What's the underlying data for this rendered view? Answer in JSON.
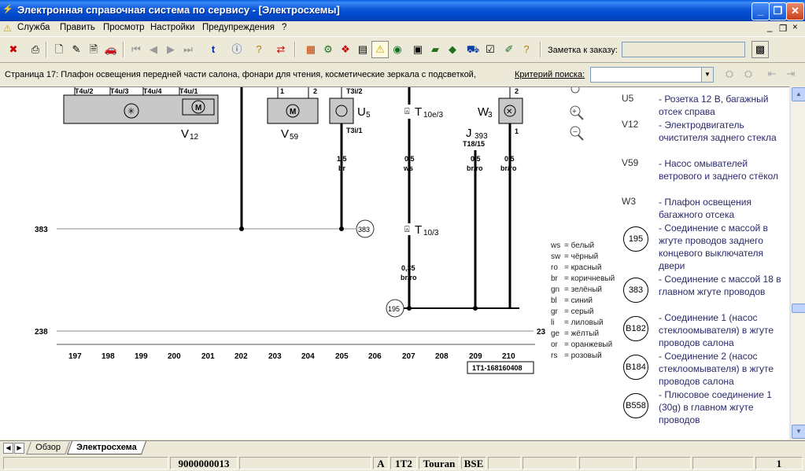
{
  "window": {
    "title": "Электронная справочная система по сервису - [Электросхемы]",
    "min": "_",
    "max": "❐",
    "close": "✕"
  },
  "menu": {
    "items": [
      "Служба",
      "Править",
      "Просмотр",
      "Настройки",
      "Предупреждения",
      "?"
    ],
    "doc_controls": [
      "_",
      "❐",
      "×"
    ]
  },
  "toolbar": {
    "note_label": "Заметка к заказу:",
    "note_value": ""
  },
  "pageline": {
    "page_text": "Страница 17: Плафон освещения передней части салона, фонари для чтения, косметические зеркала с подсветкой,",
    "criteria_label": "Критерий поиска:",
    "criteria_value": ""
  },
  "diagram": {
    "top_pins": [
      "T4u/2",
      "T4u/3",
      "T4u/4",
      "T4u/1"
    ],
    "pins_v59": [
      "1",
      "2"
    ],
    "pin_t3i2": "T3i/2",
    "pin_t3i1": "T3i/1",
    "pin_w3_2": "2",
    "pin_w3_1": "1",
    "labels": {
      "v12": "V",
      "v12_sub": "12",
      "v59": "V",
      "v59_sub": "59",
      "u5": "U",
      "u5_sub": "5",
      "w3": "W",
      "w3_sub": "3",
      "t10e3": "T",
      "t10e3_sub": "10e/3",
      "t103": "T",
      "t103_sub": "10/3",
      "j393": "J",
      "j393_sub": "393",
      "t1815": "T18/15"
    },
    "wires": [
      {
        "gauge": "1,5",
        "color": "br"
      },
      {
        "gauge": "0,5",
        "color": "ws"
      },
      {
        "gauge": "0,5",
        "color": "br/ro"
      },
      {
        "gauge": "0,5",
        "color": "br/ro"
      },
      {
        "gauge": "0,35",
        "color": "br/ro"
      }
    ],
    "rail_383": "383",
    "rail_238": "238",
    "rail_238_right": "23",
    "circle_383": "383",
    "circle_195": "195",
    "columns": [
      "197",
      "198",
      "199",
      "200",
      "201",
      "202",
      "203",
      "204",
      "205",
      "206",
      "207",
      "208",
      "209",
      "210"
    ],
    "drawing_id": "1T1-168160408"
  },
  "color_codes": [
    {
      "code": "ws",
      "name": "= белый"
    },
    {
      "code": "sw",
      "name": "= чёрный"
    },
    {
      "code": "ro",
      "name": "= красный"
    },
    {
      "code": "br",
      "name": "= коричневый"
    },
    {
      "code": "gn",
      "name": "= зелёный"
    },
    {
      "code": "bl",
      "name": "= синий"
    },
    {
      "code": "gr",
      "name": "= серый"
    },
    {
      "code": "li",
      "name": "= лиловый"
    },
    {
      "code": "ge",
      "name": "= жёлтый"
    },
    {
      "code": "or",
      "name": "= оранжевый"
    },
    {
      "code": "rs",
      "name": "= розовый"
    }
  ],
  "legend": [
    {
      "code": "U5",
      "desc": "- Розетка 12 В, багажный отсек справа"
    },
    {
      "code": "V12",
      "desc": "- Электродвигатель очистителя заднего стекла"
    },
    {
      "code": "V59",
      "desc": "- Насос омывателей ветрового и заднего стёкол"
    },
    {
      "code": "W3",
      "desc": "- Плафон освещения багажного отсека"
    },
    {
      "circle": "195",
      "desc": "- Соединение с массой в жгуте проводов заднего концевого выключателя двери"
    },
    {
      "circle": "383",
      "desc": "- Соединение с массой 18 в главном жгуте проводов"
    },
    {
      "circle": "B182",
      "desc": "- Соединение 1 (насос стеклоомывателя) в жгуте проводов салона"
    },
    {
      "circle": "B184",
      "desc": "- Соединение 2 (насос стеклоомывателя) в жгуте проводов салона"
    },
    {
      "circle": "B558",
      "desc": "- Плюсовое соединение 1 (30g) в главном жгуте проводов"
    }
  ],
  "tabs": {
    "overview": "Обзор",
    "diagram": "Электросхема"
  },
  "status": {
    "order_no": "9000000013",
    "mode": "A",
    "model_code": "1T2",
    "model": "Touran",
    "engine": "BSE",
    "page": "1"
  }
}
